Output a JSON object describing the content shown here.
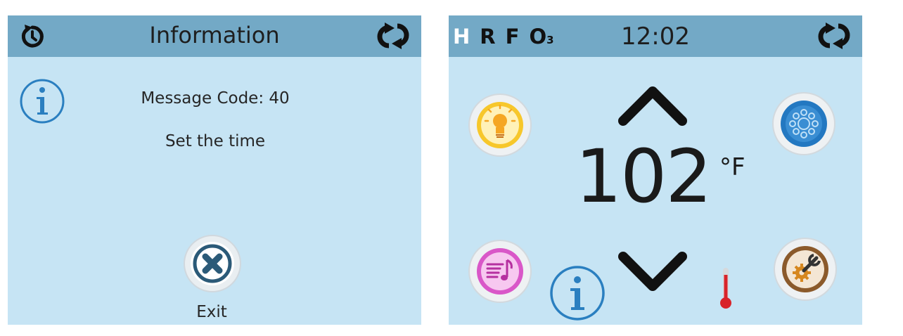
{
  "info_screen": {
    "title": "Information",
    "message_code": "Message Code: 40",
    "message": "Set the time",
    "exit_label": "Exit",
    "icons": [
      "reset-icon",
      "refresh-icon",
      "info-icon",
      "close-icon"
    ]
  },
  "home_screen": {
    "modes": [
      {
        "label": "H",
        "active": true
      },
      {
        "label": "R",
        "active": false
      },
      {
        "label": "F",
        "active": false
      },
      {
        "label": "O",
        "sub": "3",
        "active": false
      }
    ],
    "time": "12:02",
    "temperature": "102",
    "unit": "°F",
    "icons": [
      "refresh-icon",
      "light-bulb-icon",
      "jets-icon",
      "music-icon",
      "settings-icon",
      "info-icon",
      "up-arrow-icon",
      "down-arrow-icon",
      "thermometer-icon"
    ]
  },
  "colors": {
    "screen_bg": "#c6e4f4",
    "bar_bg": "#73a9c6",
    "info_blue": "#2a7fc0",
    "light_yellow": "#f7c72b",
    "jets_blue": "#2378c1",
    "music_pink": "#d957c8",
    "settings_brown": "#8b5a2b"
  }
}
